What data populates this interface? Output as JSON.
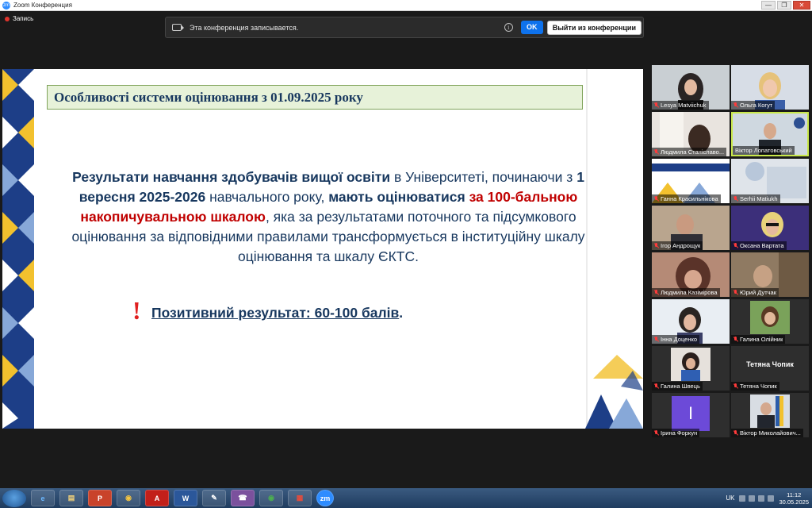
{
  "window": {
    "title": "Zoom Конференция",
    "icon": "zoom-app-icon",
    "controls": {
      "minimize": "—",
      "restore": "❐",
      "close": "✕"
    }
  },
  "recording": {
    "label": "Запись",
    "banner_text": "Эта конференция записывается.",
    "ok_label": "OK",
    "leave_label": "Выйти из конференции",
    "info_icon": "i"
  },
  "slide": {
    "heading": "Особливості системи оцінювання з 01.09.2025 року",
    "body_parts": {
      "p1": "Результати навчання здобувачів вищої освіти",
      "p2": " в Університеті, починаючи з ",
      "p3": "1 вересня 2025-2026",
      "p4": " навчального року, ",
      "p5": "мають оцінюватися",
      "p6": " ",
      "p7": "за 100-бальною накопичувальною шкалою",
      "p8": ", яка за результатами поточного та підсумкового оцінювання за відповідними правилами трансформується в інституційну шкалу оцінювання та шкалу ЄКТС."
    },
    "exclaim": "!",
    "positive_underlined": "Позитивний результат: 60-100 балів",
    "positive_end": "."
  },
  "participants": [
    {
      "name": "Lesya Matviichuk",
      "muted": true
    },
    {
      "name": "Ольга Когут",
      "muted": true
    },
    {
      "name": "Людмила Станіславо...",
      "muted": true
    },
    {
      "name": "Віктор Лопатовський",
      "muted": false,
      "active_speaker": true
    },
    {
      "name": "Ганна Красильнікова",
      "muted": true
    },
    {
      "name": "Serhii Matiukh",
      "muted": true
    },
    {
      "name": "Ігор Андрощук",
      "muted": true
    },
    {
      "name": "Оксана Вартата",
      "muted": true
    },
    {
      "name": "Людмила Казімірова",
      "muted": true
    },
    {
      "name": "Юрий Дутчак",
      "muted": true
    },
    {
      "name": "Інна Доценко",
      "muted": true
    },
    {
      "name": "Галина Олійник",
      "muted": true
    },
    {
      "name": "Галина Швець",
      "muted": true
    },
    {
      "name": "Тетяна Чопик",
      "muted": true,
      "video_off": true,
      "center_name": "Тетяна Чопик"
    },
    {
      "name": "Ірина Форкун",
      "muted": true,
      "avatar_letter": "I"
    },
    {
      "name": "Віктор Миколайович...",
      "muted": true
    }
  ],
  "taskbar": {
    "apps": [
      "ie-icon",
      "explorer-icon",
      "powerpoint-icon",
      "chrome-icon",
      "acrobat-icon",
      "word-icon",
      "paint-icon",
      "viber-icon",
      "chrome-2-icon",
      "image-viewer-icon",
      "zoom-icon"
    ],
    "app_glyphs": [
      "e",
      "▤",
      "P",
      "◉",
      "A",
      "W",
      "✎",
      "☎",
      "◉",
      "▦",
      "zm"
    ],
    "language": "UK",
    "time": "11:12",
    "date": "30.05.2025"
  }
}
